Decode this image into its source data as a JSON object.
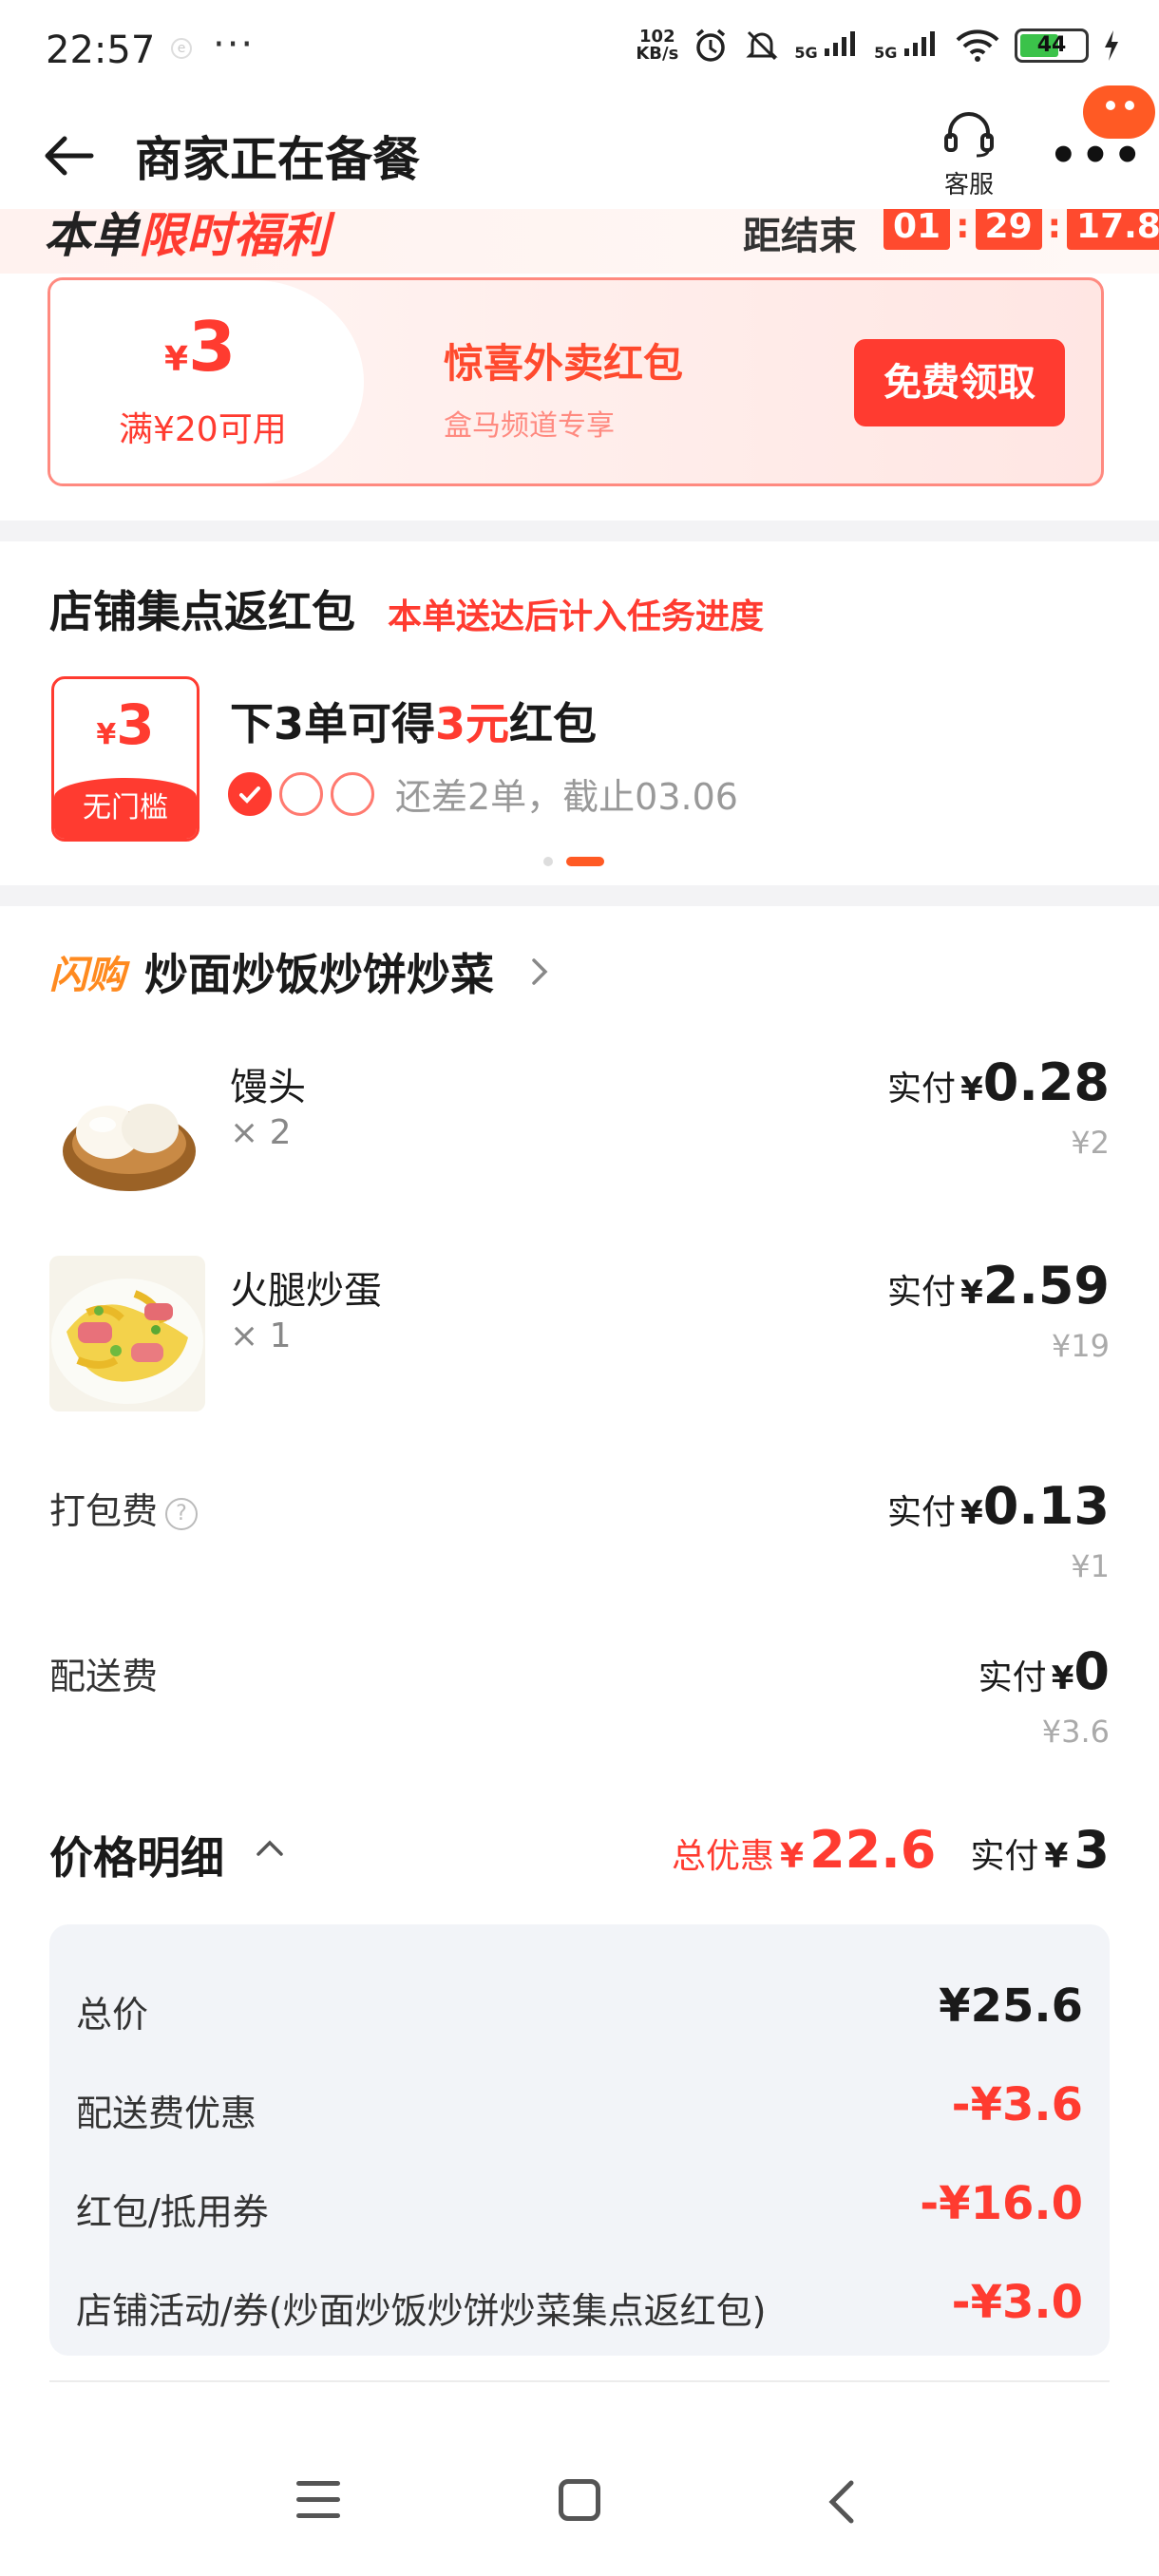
{
  "status_bar": {
    "time": "22:57",
    "dots": "···",
    "net_speed_value": "102",
    "net_speed_unit": "KB/s",
    "signal1": "5G",
    "signal2": "5G",
    "battery": "44"
  },
  "header": {
    "title": "商家正在备餐",
    "service_label": "客服",
    "more": "•••"
  },
  "promo_strip": {
    "left_black": "本单",
    "left_red": "限时福利",
    "end_label": "距结束",
    "timer": [
      "01",
      "29",
      "17.8"
    ]
  },
  "coupon": {
    "yen": "¥",
    "amount": "3",
    "condition": "满¥20可用",
    "title": "惊喜外卖红包",
    "subtitle": "盒马频道专享",
    "button": "免费领取"
  },
  "collect": {
    "title": "店铺集点返红包",
    "subtitle": "本单送达后计入任务进度",
    "badge_yen": "¥",
    "badge_amount": "3",
    "badge_label": "无门槛",
    "task_prefix": "下3单可得",
    "task_red": "3元",
    "task_suffix": "红包",
    "task_rest": "还差2单，截止03.06",
    "progress_done": 1,
    "progress_total": 3
  },
  "store": {
    "tag": "闪购",
    "name": "炒面炒饭炒饼炒菜"
  },
  "items": [
    {
      "name": "馒头",
      "qty": "× 2",
      "pay_label": "实付",
      "yen": "¥",
      "pay": "0.28",
      "orig": "¥2"
    },
    {
      "name": "火腿炒蛋",
      "qty": "× 1",
      "pay_label": "实付",
      "yen": "¥",
      "pay": "2.59",
      "orig": "¥19"
    }
  ],
  "fees": [
    {
      "name": "打包费",
      "help": "?",
      "pay_label": "实付",
      "yen": "¥",
      "pay": "0.13",
      "orig": "¥1"
    },
    {
      "name": "配送费",
      "pay_label": "实付",
      "yen": "¥",
      "pay": "0",
      "orig": "¥3.6"
    }
  ],
  "detail": {
    "title": "价格明细",
    "discount_label": "总优惠",
    "discount_yen": "¥",
    "discount": "22.6",
    "pay_label": "实付",
    "pay_yen": "¥",
    "pay": "3",
    "rows": [
      {
        "k": "总价",
        "v": "¥25.6"
      },
      {
        "k": "配送费优惠",
        "v": "-¥3.6"
      },
      {
        "k": "红包/抵用券",
        "v": "-¥16.0"
      },
      {
        "k": "店铺活动/券(炒面炒饭炒饼炒菜集点返红包)",
        "v": "-¥3.0"
      }
    ]
  },
  "colors": {
    "accent_red": "#ff3b30",
    "brand_orange": "#ff5a24",
    "shangou_orange": "#ff8a1f"
  }
}
